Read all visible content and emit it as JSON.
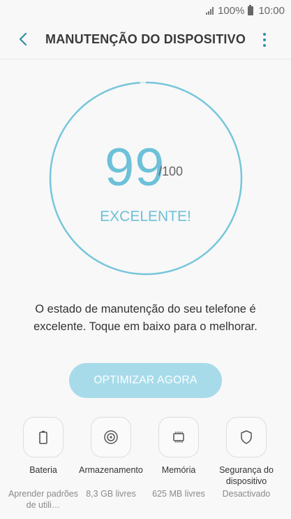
{
  "status_bar": {
    "battery_percent": "100%",
    "time": "10:00"
  },
  "header": {
    "title": "MANUTENÇÃO DO DISPOSITIVO",
    "back_icon": "chevron-left-icon",
    "menu_icon": "more-vert-icon"
  },
  "score": {
    "value": "99",
    "max": "/100",
    "status": "EXCELENTE!",
    "fraction": 0.99,
    "ring_color": "#77c6dc"
  },
  "description": "O estado de manutenção do seu telefone é excelente. Toque em baixo para o melhorar.",
  "optimize_button": {
    "label": "OPTIMIZAR AGORA",
    "color": "#a7dbea"
  },
  "tiles": [
    {
      "label": "Bateria",
      "sub": "Aprender padrões de utili…",
      "icon": "battery-icon"
    },
    {
      "label": "Armazenamento",
      "sub": "8,3 GB livres",
      "icon": "storage-icon"
    },
    {
      "label": "Memória",
      "sub": "625 MB livres",
      "icon": "memory-chip-icon"
    },
    {
      "label": "Segurança do dispositivo",
      "sub": "Desactivado",
      "icon": "shield-icon"
    }
  ]
}
